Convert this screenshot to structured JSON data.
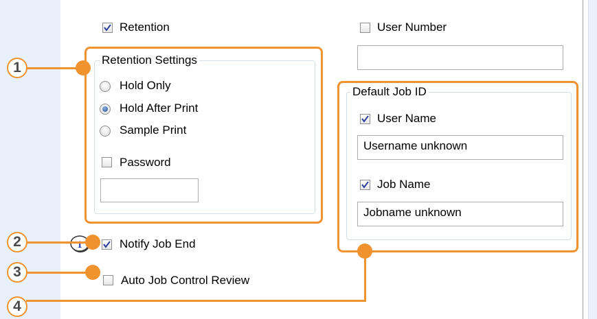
{
  "retention": {
    "label": "Retention",
    "checked": true
  },
  "retention_settings": {
    "title": "Retention Settings",
    "options": [
      {
        "label": "Hold Only",
        "selected": false
      },
      {
        "label": "Hold After Print",
        "selected": true
      },
      {
        "label": "Sample Print",
        "selected": false
      }
    ],
    "password": {
      "label": "Password",
      "checked": false,
      "value": ""
    }
  },
  "user_number": {
    "label": "User Number",
    "checked": false,
    "value": ""
  },
  "default_job_id": {
    "title": "Default Job ID",
    "user_name": {
      "label": "User Name",
      "checked": true,
      "value": "Username unknown"
    },
    "job_name": {
      "label": "Job Name",
      "checked": true,
      "value": "Jobname unknown"
    }
  },
  "notify_job_end": {
    "label": "Notify Job End",
    "checked": true
  },
  "auto_job_control_review": {
    "label": "Auto Job Control Review",
    "checked": false
  },
  "callouts": [
    "1",
    "2",
    "3",
    "4"
  ],
  "colors": {
    "accent": "#f0922e",
    "panel": "#ffffff",
    "background": "#e8f1fa"
  }
}
